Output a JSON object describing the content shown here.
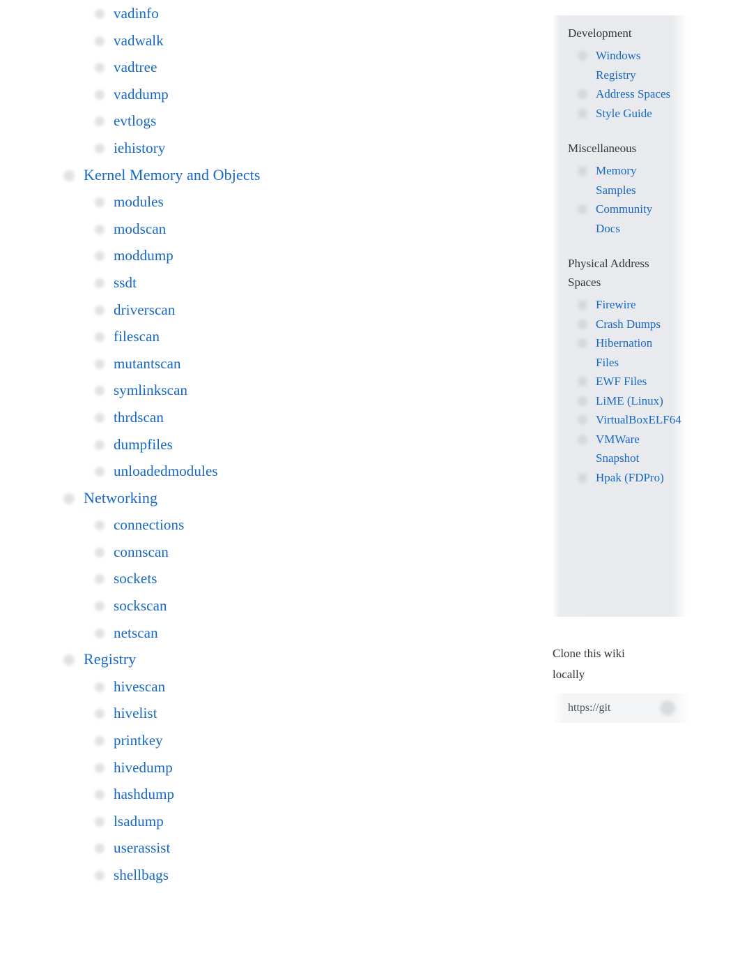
{
  "main": {
    "items": [
      {
        "label": "vadinfo",
        "level": 2,
        "icon": "page-bullet-icon"
      },
      {
        "label": "vadwalk",
        "level": 2,
        "icon": "page-bullet-icon"
      },
      {
        "label": "vadtree",
        "level": 2,
        "icon": "page-bullet-icon"
      },
      {
        "label": "vaddump",
        "level": 2,
        "icon": "page-bullet-icon"
      },
      {
        "label": "evtlogs",
        "level": 2,
        "icon": "page-bullet-icon"
      },
      {
        "label": "iehistory",
        "level": 2,
        "icon": "page-bullet-icon"
      },
      {
        "label": "Kernel Memory and Objects",
        "level": 1,
        "icon": "page-bullet-icon"
      },
      {
        "label": "modules",
        "level": 2,
        "icon": "page-bullet-icon"
      },
      {
        "label": "modscan",
        "level": 2,
        "icon": "page-bullet-icon"
      },
      {
        "label": "moddump",
        "level": 2,
        "icon": "page-bullet-icon"
      },
      {
        "label": "ssdt",
        "level": 2,
        "icon": "page-bullet-icon"
      },
      {
        "label": "driverscan",
        "level": 2,
        "icon": "page-bullet-icon"
      },
      {
        "label": "filescan",
        "level": 2,
        "icon": "page-bullet-icon"
      },
      {
        "label": "mutantscan",
        "level": 2,
        "icon": "page-bullet-icon"
      },
      {
        "label": "symlinkscan",
        "level": 2,
        "icon": "page-bullet-icon"
      },
      {
        "label": "thrdscan",
        "level": 2,
        "icon": "page-bullet-icon"
      },
      {
        "label": "dumpfiles",
        "level": 2,
        "icon": "page-bullet-icon"
      },
      {
        "label": "unloadedmodules",
        "level": 2,
        "icon": "page-bullet-icon"
      },
      {
        "label": "Networking",
        "level": 1,
        "icon": "page-bullet-icon"
      },
      {
        "label": "connections",
        "level": 2,
        "icon": "page-bullet-icon"
      },
      {
        "label": "connscan",
        "level": 2,
        "icon": "page-bullet-icon"
      },
      {
        "label": "sockets",
        "level": 2,
        "icon": "page-bullet-icon"
      },
      {
        "label": "sockscan",
        "level": 2,
        "icon": "page-bullet-icon"
      },
      {
        "label": "netscan",
        "level": 2,
        "icon": "page-bullet-icon"
      },
      {
        "label": "Registry",
        "level": 1,
        "icon": "page-bullet-icon"
      },
      {
        "label": "hivescan",
        "level": 2,
        "icon": "page-bullet-icon"
      },
      {
        "label": "hivelist",
        "level": 2,
        "icon": "page-bullet-icon"
      },
      {
        "label": "printkey",
        "level": 2,
        "icon": "page-bullet-icon"
      },
      {
        "label": "hivedump",
        "level": 2,
        "icon": "page-bullet-icon"
      },
      {
        "label": "hashdump",
        "level": 2,
        "icon": "page-bullet-icon"
      },
      {
        "label": "lsadump",
        "level": 2,
        "icon": "page-bullet-icon"
      },
      {
        "label": "userassist",
        "level": 2,
        "icon": "page-bullet-icon"
      },
      {
        "label": "shellbags",
        "level": 2,
        "icon": "page-bullet-icon"
      }
    ]
  },
  "sidebar": {
    "sections": [
      {
        "heading": "Development",
        "items": [
          {
            "label": "Windows Registry",
            "icon": "page-bullet-icon"
          },
          {
            "label": "Address Spaces",
            "icon": "page-bullet-icon"
          },
          {
            "label": "Style Guide",
            "icon": "page-bullet-icon"
          }
        ]
      },
      {
        "heading": "Miscellaneous",
        "items": [
          {
            "label": "Memory Samples",
            "icon": "page-bullet-icon"
          },
          {
            "label": "Community Docs",
            "icon": "page-bullet-icon"
          }
        ]
      },
      {
        "heading": "Physical Address Spaces",
        "items": [
          {
            "label": "Firewire",
            "icon": "page-bullet-icon"
          },
          {
            "label": "Crash Dumps",
            "icon": "page-bullet-icon"
          },
          {
            "label": "Hibernation Files",
            "icon": "page-bullet-icon"
          },
          {
            "label": "EWF Files",
            "icon": "page-bullet-icon"
          },
          {
            "label": "LiME (Linux)",
            "icon": "page-bullet-icon"
          },
          {
            "label": "VirtualBoxELF64",
            "icon": "page-bullet-icon"
          },
          {
            "label": "VMWare Snapshot",
            "icon": "page-bullet-icon"
          },
          {
            "label": "Hpak (FDPro)",
            "icon": "page-bullet-icon"
          }
        ]
      }
    ]
  },
  "clone": {
    "title": "Clone this wiki locally",
    "url_value": "https://git",
    "url_placeholder": "https://git",
    "copy_icon": "copy-to-clipboard-icon"
  },
  "colors": {
    "link": "#1668c4",
    "heading_text": "#31363b",
    "sidebar_background": "#e7e9ec",
    "clone_box_background": "#f3f4f5",
    "bullet": "#d9dcdf",
    "page_background": "#ffffff"
  }
}
